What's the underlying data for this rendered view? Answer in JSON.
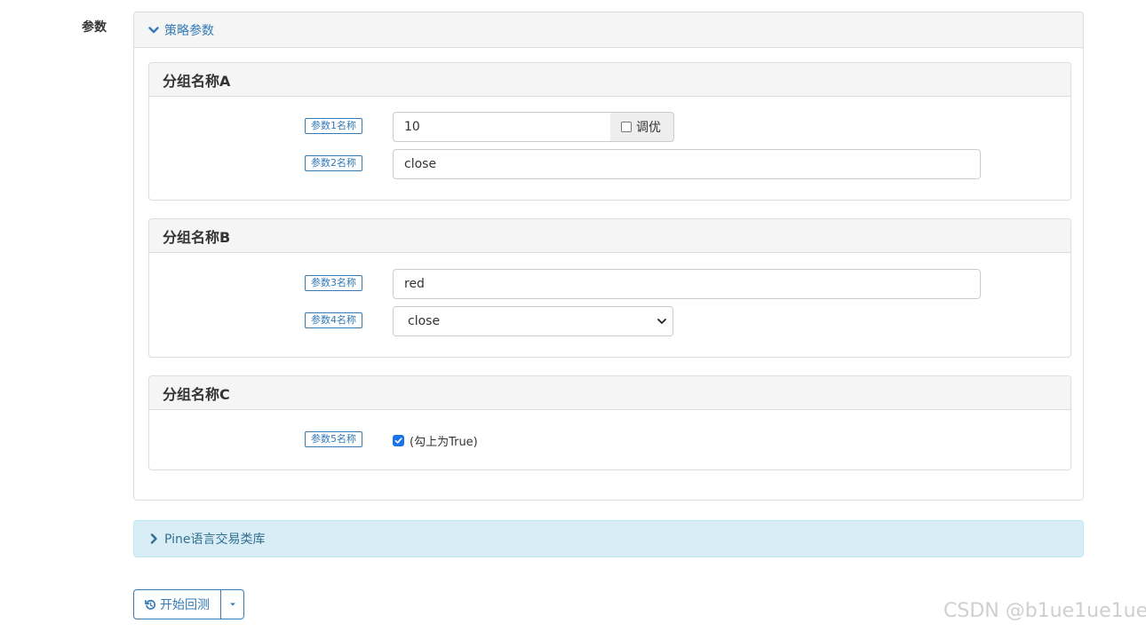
{
  "side_label": "参数",
  "strategy_panel": {
    "title": "策略参数",
    "groups": [
      {
        "title": "分组名称A",
        "params": [
          {
            "label": "参数1名称",
            "value": "10",
            "optimize_label": "调优",
            "optimize_checked": false
          },
          {
            "label": "参数2名称",
            "value": "close"
          }
        ]
      },
      {
        "title": "分组名称B",
        "params": [
          {
            "label": "参数3名称",
            "value": "red"
          },
          {
            "label": "参数4名称",
            "selected": "close"
          }
        ]
      },
      {
        "title": "分组名称C",
        "params": [
          {
            "label": "参数5名称",
            "checked": true,
            "check_label": "(勾上为True)"
          }
        ]
      }
    ]
  },
  "pine_panel": {
    "title": "Pine语言交易类库"
  },
  "backtest_button": {
    "label": "开始回测"
  },
  "watermark": "CSDN @b1ue1ue1ue",
  "colors": {
    "primary": "#337ab7",
    "info_bg": "#d9edf7",
    "info_text": "#31708f",
    "checkbox": "#1a73e8"
  }
}
